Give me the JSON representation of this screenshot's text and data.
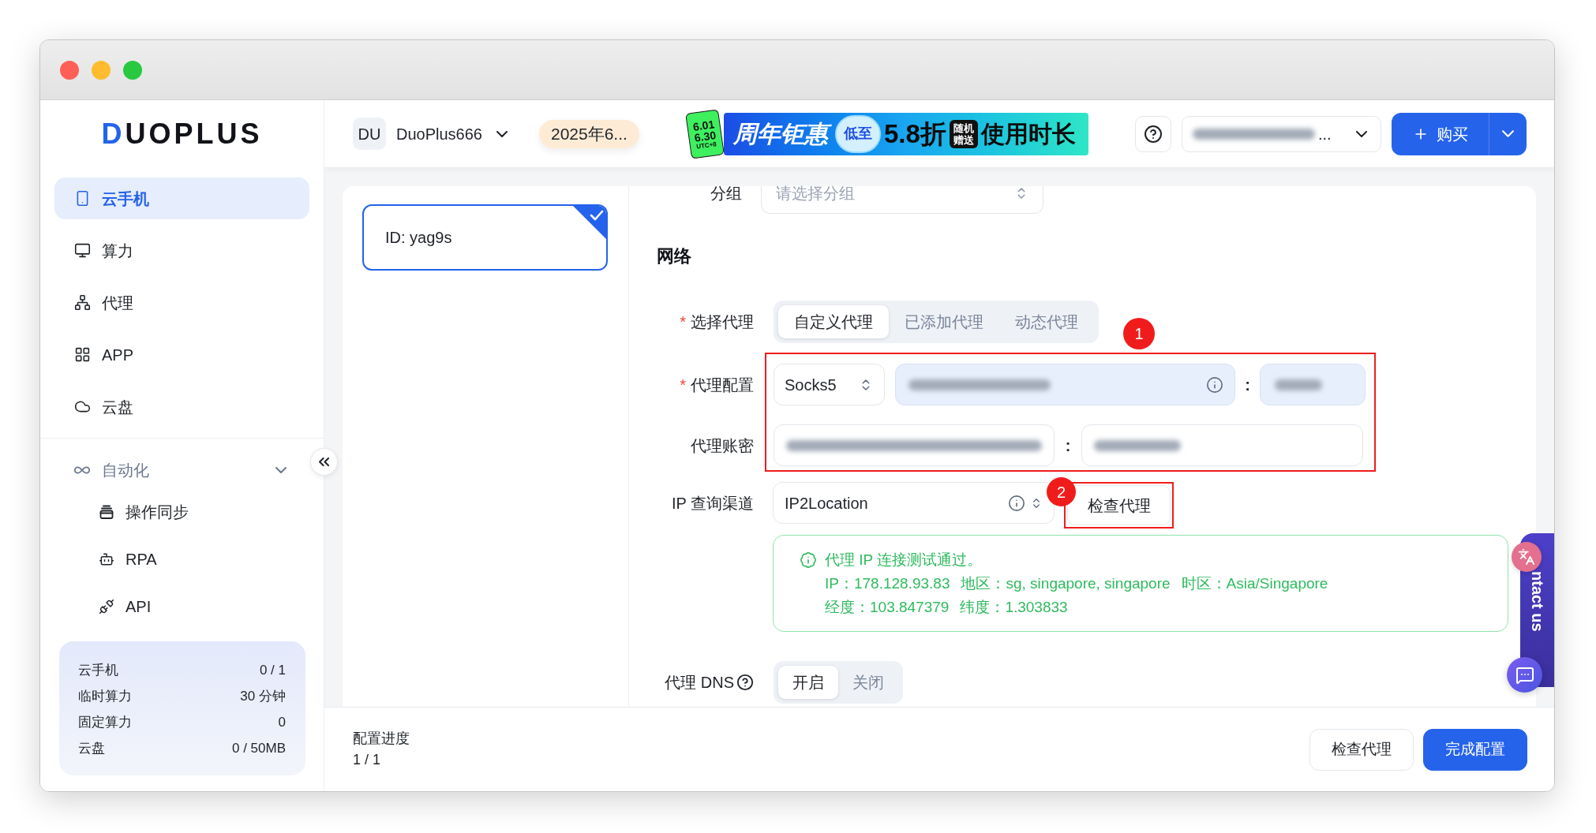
{
  "window": {
    "controls": [
      {
        "color": "#ff5f57"
      },
      {
        "color": "#febc2e"
      },
      {
        "color": "#28c840"
      }
    ]
  },
  "sidebar": {
    "logo": "DUOPLUS",
    "items": [
      {
        "label": "云手机",
        "selected": true
      },
      {
        "label": "算力",
        "selected": false
      },
      {
        "label": "代理",
        "selected": false
      },
      {
        "label": "APP",
        "selected": false
      },
      {
        "label": "云盘",
        "selected": false
      }
    ],
    "groups": [
      {
        "label": "自动化",
        "expanded": true,
        "children": [
          {
            "label": "操作同步"
          },
          {
            "label": "RPA"
          },
          {
            "label": "API"
          }
        ]
      }
    ],
    "stats": [
      {
        "label": "云手机",
        "value": "0 / 1"
      },
      {
        "label": "临时算力",
        "value": "30 分钟"
      },
      {
        "label": "固定算力",
        "value": "0"
      },
      {
        "label": "云盘",
        "value": "0 / 50MB"
      }
    ]
  },
  "header": {
    "workspace": {
      "avatar": "DU",
      "name": "DuoPlus666"
    },
    "date": "2025年6...",
    "banner": {
      "tag": [
        "6.01",
        "6.30",
        "UTC+8"
      ],
      "headline": "周年钜惠",
      "badge": "低至",
      "discount": "5.8折",
      "gift": "随机赠送",
      "tagline": "使用时长"
    },
    "account": {
      "redacted": true,
      "ellipsis": "..."
    },
    "buy_button": "购买"
  },
  "devices": [
    {
      "label": "ID: yag9s",
      "selected": true
    }
  ],
  "form": {
    "group": {
      "label": "分组",
      "placeholder": "请选择分组"
    },
    "section_title": "网络",
    "proxy_type": {
      "marker": "*",
      "label": "选择代理",
      "options": [
        {
          "label": "自定义代理",
          "selected": true
        },
        {
          "label": "已添加代理",
          "selected": false
        },
        {
          "label": "动态代理",
          "selected": false
        }
      ]
    },
    "proxy_config": {
      "marker": "*",
      "label": "代理配置",
      "protocol": "Socks5",
      "host": {
        "redacted": true
      },
      "separator": ":",
      "port": {
        "redacted": true
      }
    },
    "proxy_auth": {
      "label": "代理账密",
      "username": {
        "redacted": true
      },
      "separator": ":",
      "password": {
        "redacted": true
      }
    },
    "ip_lookup": {
      "label": "IP 查询渠道",
      "value": "IP2Location",
      "check_button": "检查代理"
    },
    "result": {
      "message": "代理 IP 连接测试通过。",
      "lines": [
        [
          "IP：178.128.93.83",
          "地区：sg, singapore, singapore",
          "时区：Asia/Singapore"
        ],
        [
          "经度：103.847379",
          "纬度：1.303833"
        ]
      ]
    },
    "proxy_dns": {
      "label": "代理 DNS",
      "options": [
        {
          "label": "开启",
          "selected": true
        },
        {
          "label": "关闭",
          "selected": false
        }
      ]
    },
    "annotations": [
      {
        "number": "1"
      },
      {
        "number": "2"
      }
    ]
  },
  "footer": {
    "progress_label": "配置进度",
    "progress_value": "1 / 1",
    "buttons": [
      {
        "label": "检查代理",
        "kind": "secondary"
      },
      {
        "label": "完成配置",
        "kind": "primary"
      }
    ]
  },
  "contact_tab": {
    "label": "ntact us"
  }
}
